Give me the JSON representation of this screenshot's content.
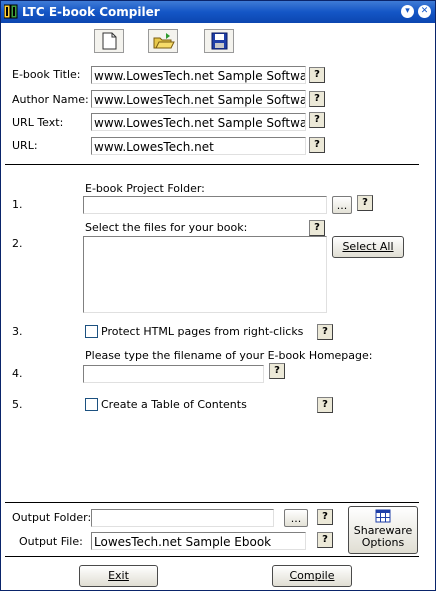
{
  "window": {
    "title": "LTC E-book Compiler",
    "minimize_glyph": "▾",
    "close_glyph": "✕",
    "icon": "book-icon"
  },
  "toolbar": {
    "new_icon": "new-document-icon",
    "open_icon": "open-folder-icon",
    "save_icon": "save-disk-icon"
  },
  "fields": {
    "ebook_title": {
      "label": "E-book Title:",
      "value": "www.LowesTech.net Sample Software"
    },
    "author_name": {
      "label": "Author Name:",
      "value": "www.LowesTech.net Sample Software"
    },
    "url_text": {
      "label": "URL Text:",
      "value": "www.LowesTech.net Sample Software"
    },
    "url": {
      "label": "URL:",
      "value": "www.LowesTech.net"
    }
  },
  "help_glyph": "?",
  "browse_glyph": "...",
  "steps": {
    "s1": {
      "number": "1.",
      "label": "E-book Project Folder:",
      "value": ""
    },
    "s2": {
      "number": "2.",
      "label": "Select the files for your book:",
      "select_all": "Select All"
    },
    "s3": {
      "number": "3.",
      "label": "Protect HTML pages from right-clicks",
      "checked": false
    },
    "s4": {
      "number": "4.",
      "label": "Please type the filename of your E-book Homepage:",
      "value": ""
    },
    "s5": {
      "number": "5.",
      "label": "Create a Table of Contents",
      "checked": false
    }
  },
  "output": {
    "folder_label": "Output Folder:",
    "folder_value": "",
    "file_label": "Output File:",
    "file_value": "LowesTech.net Sample Ebook",
    "shareware_line1": "Shareware",
    "shareware_line2": "Options"
  },
  "buttons": {
    "exit": "Exit",
    "compile": "Compile"
  }
}
